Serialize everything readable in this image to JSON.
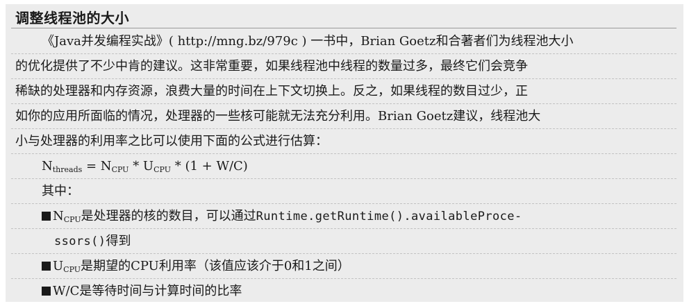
{
  "title": "调整线程池的大小",
  "paragraph": [
    "《Java并发编程实战》( http://mng.bz/979c ) 一书中，Brian Goetz和合著者们为线程池大小",
    "的优化提供了不少中肯的建议。这非常重要，如果线程池中线程的数量过多，最终它们会竞争",
    "稀缺的处理器和内存资源，浪费大量的时间在上下文切换上。反之，如果线程的数目过少，正",
    "如你的应用所面临的情况，处理器的一些核可能就无法充分利用。Brian Goetz建议，线程池大",
    "小与处理器的利用率之比可以使用下面的公式进行估算："
  ],
  "formula": {
    "n": "N",
    "n_sub": "threads",
    "eq": " = N",
    "cpu1": "CPU",
    "mul": " * U",
    "cpu2": "CPU",
    "rest": " * (1 + W/C)"
  },
  "where_label": "其中：",
  "items": [
    {
      "sym": "N",
      "sub": "CPU",
      "text": "是处理器的核的数目，可以通过",
      "code": "Runtime.getRuntime().availableProce-",
      "code_cont": "ssors()",
      "tail": "得到"
    },
    {
      "sym": "U",
      "sub": "CPU",
      "text": "是期望的CPU利用率（该值应该介于0和1之间）"
    },
    {
      "sym": "W/C",
      "text": "是等待时间与计算时间的比率"
    }
  ]
}
